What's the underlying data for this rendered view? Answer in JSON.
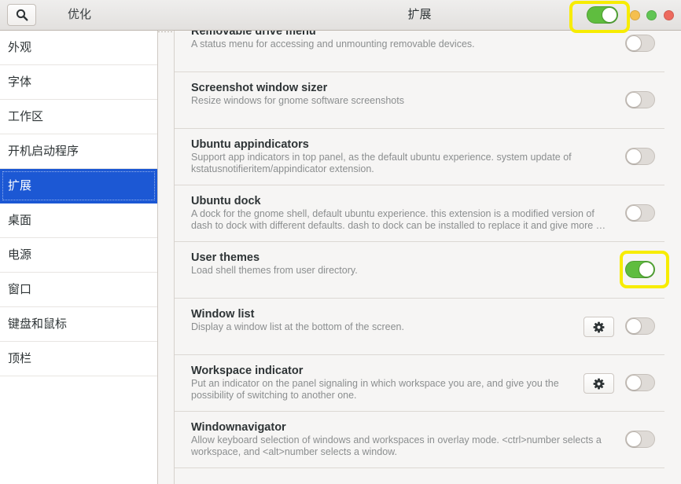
{
  "window": {
    "app_title": "优化",
    "page_title": "扩展"
  },
  "header": {
    "search_icon": "search-icon",
    "extensions_switch": {
      "on": true,
      "highlighted": true
    }
  },
  "sidebar": {
    "items": [
      {
        "label": "外观",
        "selected": false
      },
      {
        "label": "字体",
        "selected": false
      },
      {
        "label": "工作区",
        "selected": false
      },
      {
        "label": "开机启动程序",
        "selected": false
      },
      {
        "label": "扩展",
        "selected": true
      },
      {
        "label": "桌面",
        "selected": false
      },
      {
        "label": "电源",
        "selected": false
      },
      {
        "label": "窗口",
        "selected": false
      },
      {
        "label": "键盘和鼠标",
        "selected": false
      },
      {
        "label": "顶栏",
        "selected": false
      }
    ]
  },
  "extensions": [
    {
      "name": "Removable drive menu",
      "description_lines": [
        "A status menu for accessing and unmounting removable devices."
      ],
      "enabled": false,
      "has_settings": false,
      "highlighted": false
    },
    {
      "name": "Screenshot window sizer",
      "description_lines": [
        "Resize windows for gnome software screenshots"
      ],
      "enabled": false,
      "has_settings": false,
      "highlighted": false
    },
    {
      "name": "Ubuntu appindicators",
      "description_lines": [
        "Support app indicators in top panel, as the default ubuntu experience. system update of",
        "kstatusnotifieritem/appindicator extension."
      ],
      "enabled": false,
      "has_settings": false,
      "highlighted": false
    },
    {
      "name": "Ubuntu dock",
      "description_lines": [
        "A dock for the gnome shell, default ubuntu experience. this extension is a modified version of",
        "dash to dock with different defaults. dash to dock can be installed to replace it and give more …"
      ],
      "enabled": false,
      "has_settings": false,
      "highlighted": false
    },
    {
      "name": "User themes",
      "description_lines": [
        "Load shell themes from user directory."
      ],
      "enabled": true,
      "has_settings": false,
      "highlighted": true
    },
    {
      "name": "Window list",
      "description_lines": [
        "Display a window list at the bottom of the screen."
      ],
      "enabled": false,
      "has_settings": true,
      "highlighted": false
    },
    {
      "name": "Workspace indicator",
      "description_lines": [
        "Put an indicator on the panel signaling in which workspace you are, and give you the",
        "possibility of switching to another one."
      ],
      "enabled": false,
      "has_settings": true,
      "highlighted": false
    },
    {
      "name": "Windownavigator",
      "description_lines": [
        "Allow keyboard selection of windows and workspaces in overlay mode. <ctrl>number selects a",
        "workspace, and <alt>number selects a window."
      ],
      "enabled": false,
      "has_settings": false,
      "highlighted": false
    }
  ],
  "icons": {
    "settings": "gear-icon",
    "search": "search-icon"
  },
  "colors": {
    "accent": "#1c58d4",
    "switch_on": "#5fbd3f",
    "highlight": "#f7ec00",
    "window_controls": [
      "#f5bf4f",
      "#61c554",
      "#ed6a5e"
    ]
  }
}
